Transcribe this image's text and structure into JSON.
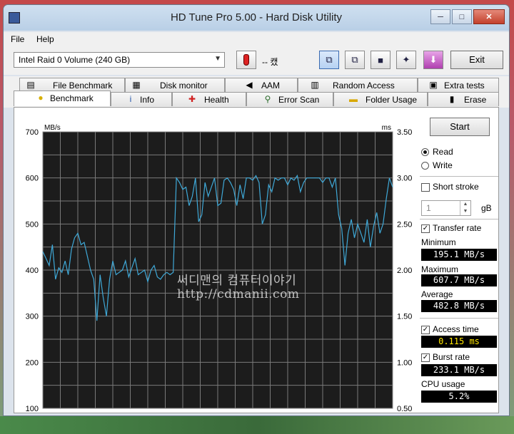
{
  "window": {
    "title": "HD Tune Pro 5.00 - Hard Disk Utility",
    "min_glyph": "─",
    "max_glyph": "□",
    "close_glyph": "✕"
  },
  "menu": {
    "file": "File",
    "help": "Help"
  },
  "toolbar": {
    "drive": "Intel   Raid 0 Volume (240 GB)",
    "temperature": "-- 캤",
    "exit_label": "Exit"
  },
  "tabs_top": [
    {
      "label": "File Benchmark",
      "icon": "file-benchmark-icon"
    },
    {
      "label": "Disk monitor",
      "icon": "disk-monitor-icon"
    },
    {
      "label": "AAM",
      "icon": "speaker-icon"
    },
    {
      "label": "Random Access",
      "icon": "random-access-icon"
    },
    {
      "label": "Extra tests",
      "icon": "extra-tests-icon"
    }
  ],
  "tabs_bottom": [
    {
      "label": "Benchmark",
      "icon": "lightbulb-icon"
    },
    {
      "label": "Info",
      "icon": "info-icon"
    },
    {
      "label": "Health",
      "icon": "health-cross-icon"
    },
    {
      "label": "Error Scan",
      "icon": "magnifier-icon"
    },
    {
      "label": "Folder Usage",
      "icon": "folder-icon"
    },
    {
      "label": "Erase",
      "icon": "trash-icon"
    }
  ],
  "side": {
    "start_label": "Start",
    "read_label": "Read",
    "write_label": "Write",
    "short_stroke_label": "Short stroke",
    "stroke_value": "1",
    "stroke_unit": "gB",
    "transfer_rate_label": "Transfer rate",
    "minimum_label": "Minimum",
    "minimum_value": "195.1 MB/s",
    "maximum_label": "Maximum",
    "maximum_value": "607.7 MB/s",
    "average_label": "Average",
    "average_value": "482.8 MB/s",
    "access_time_label": "Access time",
    "access_time_value": "0.115 ms",
    "burst_rate_label": "Burst rate",
    "burst_rate_value": "233.1 MB/s",
    "cpu_usage_label": "CPU usage",
    "cpu_usage_value": "5.2%"
  },
  "watermark": {
    "line1": "써디맨의 컴퓨터이야기",
    "line2": "http://cdmanii.com"
  },
  "chart_data": {
    "type": "line",
    "ylabel_left": "MB/s",
    "ylabel_right": "ms",
    "y_left_ticks": [
      "700",
      "600",
      "500",
      "400",
      "300",
      "200",
      "100"
    ],
    "y_right_ticks": [
      "3.50",
      "3.00",
      "2.50",
      "2.00",
      "1.50",
      "1.00",
      "0.50"
    ],
    "ylim_left": [
      100,
      700
    ],
    "ylim_right": [
      0.5,
      3.5
    ],
    "grid": true,
    "series": [
      {
        "color": "#3fa9d8",
        "values": [
          440,
          425,
          410,
          455,
          380,
          405,
          395,
          420,
          390,
          445,
          470,
          480,
          455,
          460,
          430,
          400,
          380,
          290,
          390,
          340,
          300,
          380,
          420,
          390,
          395,
          400,
          420,
          385,
          405,
          425,
          390,
          395,
          400,
          375,
          400,
          410,
          385,
          380,
          390,
          395,
          390,
          395,
          600,
          590,
          575,
          580,
          540,
          560,
          600,
          505,
          520,
          590,
          560,
          580,
          600,
          540,
          545,
          595,
          600,
          590,
          575,
          540,
          585,
          555,
          600,
          600,
          595,
          605,
          590,
          500,
          520,
          585,
          570,
          600,
          595,
          600,
          600,
          585,
          600,
          595,
          605,
          570,
          590,
          600,
          600,
          600,
          600,
          600,
          590,
          600,
          600,
          580,
          600,
          520,
          490,
          410,
          480,
          510,
          470,
          500,
          480,
          460,
          510,
          450,
          495,
          525,
          480,
          500,
          555,
          600,
          580
        ]
      }
    ]
  }
}
